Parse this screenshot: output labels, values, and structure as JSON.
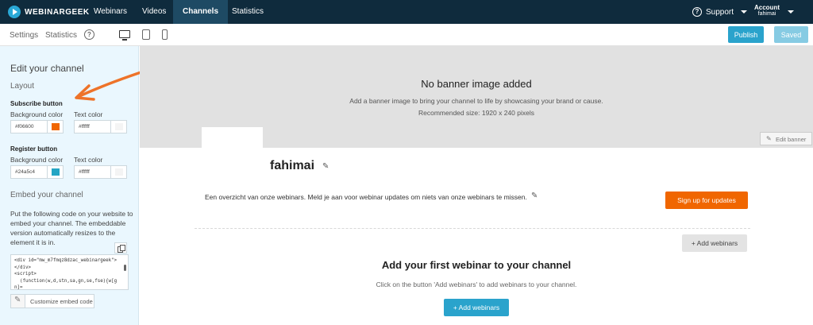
{
  "topnav": {
    "logo_text": "WEBINARGEEK",
    "items": [
      "Webinars",
      "Videos",
      "Channels",
      "Statistics"
    ],
    "active": "Channels",
    "support_label": "Support",
    "account_label": "Account",
    "account_user": "fahimai"
  },
  "subbar": {
    "settings_label": "Settings",
    "statistics_label": "Statistics",
    "help_glyph": "?",
    "publish_label": "Publish",
    "saved_label": "Saved"
  },
  "sidebar": {
    "title": "Edit your channel",
    "layout_label": "Layout",
    "subscribe_heading": "Subscribe button",
    "subscribe_bg_label": "Background color",
    "subscribe_text_label": "Text color",
    "subscribe_bg_value": "#f06600",
    "subscribe_text_value": "#ffffff",
    "register_heading": "Register button",
    "register_bg_label": "Background color",
    "register_text_label": "Text color",
    "register_bg_value": "#24a5c4",
    "register_text_value": "#ffffff",
    "embed_heading": "Embed your channel",
    "embed_text": "Put the following code on your website to embed your channel. The embeddable version automatically resizes to the element it is in.",
    "embed_code": "<div id=\"mw_m7fmqz8dzac_webinargeek\"></div>\n<script>\n  (function(w,d,stn,sa,gn,se,fse){w[gn]=",
    "customize_label": "Customize embed code"
  },
  "banner": {
    "title": "No banner image added",
    "subtitle": "Add a banner image to bring your channel to life by showcasing your brand or cause.",
    "size_hint": "Recommended size: 1920 x 240 pixels",
    "edit_label": "Edit banner"
  },
  "channel": {
    "name": "fahimai",
    "description": "Een overzicht van onze webinars. Meld je aan voor webinar updates om niets van onze webinars te missen.",
    "signup_label": "Sign up for updates",
    "add_webinars_label": "+ Add webinars",
    "empty_title": "Add your first webinar to your channel",
    "empty_subtitle": "Click on the button 'Add webinars' to add webinars to your channel.",
    "add_webinars_primary_label": "+ Add webinars"
  },
  "colors": {
    "nav_bg": "#0f2b3d",
    "accent_blue": "#2aa3cc",
    "accent_orange": "#f06600",
    "sidebar_bg": "#eaf7fe",
    "arrow": "#ee7329"
  },
  "icons": {
    "logo": "play-circle-icon",
    "support": "question-circle-icon",
    "devices": [
      "desktop-icon",
      "tablet-icon",
      "phone-icon"
    ],
    "copy": "copy-icon",
    "edit": "pencil-icon"
  }
}
